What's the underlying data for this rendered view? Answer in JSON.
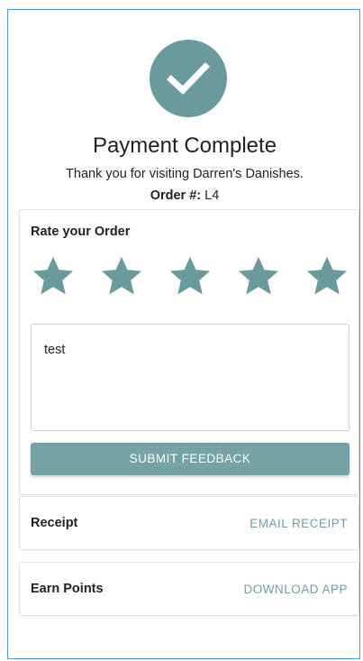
{
  "header": {
    "title": "Payment Complete",
    "message": "Thank you for visiting Darren's Danishes.",
    "order_label": "Order #:",
    "order_number": "L4",
    "icon": "checkmark-icon",
    "accent_color": "#6a9a9d"
  },
  "rating": {
    "title": "Rate your Order",
    "stars_total": 5,
    "stars_selected": 5,
    "star_color": "#6a9a9d"
  },
  "feedback": {
    "value": "test",
    "submit_label": "SUBMIT FEEDBACK"
  },
  "receipt": {
    "label": "Receipt",
    "action_label": "EMAIL RECEIPT"
  },
  "points": {
    "label": "Earn Points",
    "action_label": "DOWNLOAD APP"
  }
}
